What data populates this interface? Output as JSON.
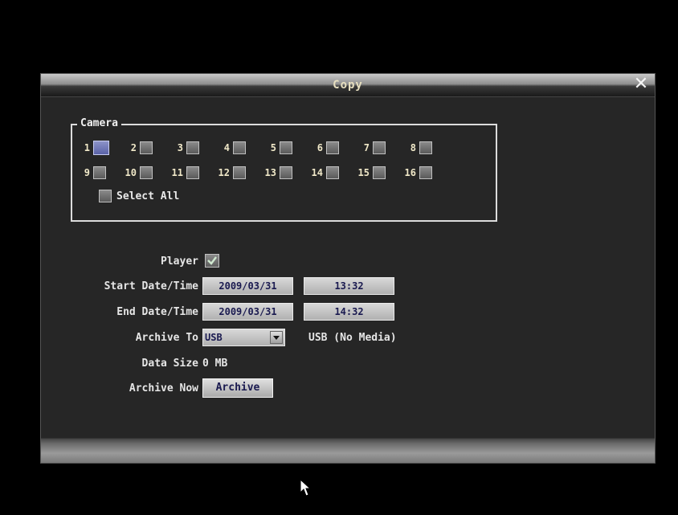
{
  "dialog": {
    "title": "Copy",
    "close_label": "✕"
  },
  "camera": {
    "legend": "Camera",
    "channels": [
      {
        "label": "1",
        "selected": true
      },
      {
        "label": "2",
        "selected": false
      },
      {
        "label": "3",
        "selected": false
      },
      {
        "label": "4",
        "selected": false
      },
      {
        "label": "5",
        "selected": false
      },
      {
        "label": "6",
        "selected": false
      },
      {
        "label": "7",
        "selected": false
      },
      {
        "label": "8",
        "selected": false
      },
      {
        "label": "9",
        "selected": false
      },
      {
        "label": "10",
        "selected": false
      },
      {
        "label": "11",
        "selected": false
      },
      {
        "label": "12",
        "selected": false
      },
      {
        "label": "13",
        "selected": false
      },
      {
        "label": "14",
        "selected": false
      },
      {
        "label": "15",
        "selected": false
      },
      {
        "label": "16",
        "selected": false
      }
    ],
    "select_all_label": "Select All"
  },
  "form": {
    "player_label": "Player",
    "player_checked": true,
    "start_label": "Start Date/Time",
    "start_date": "2009/03/31",
    "start_time": "13:32",
    "end_label": "End Date/Time",
    "end_date": "2009/03/31",
    "end_time": "14:32",
    "archive_to_label": "Archive To",
    "archive_to_value": "USB",
    "archive_status": "USB (No Media)",
    "data_size_label": "Data Size",
    "data_size_value": "0 MB",
    "archive_now_label": "Archive Now",
    "archive_button_label": "Archive"
  },
  "colors": {
    "background": "#000000",
    "dialog_bg": "#262626",
    "selected_channel": "#6a70b8",
    "field_text": "#1a1a50"
  },
  "icons": {
    "close": "close-icon",
    "dropdown": "chevron-down-icon",
    "check": "checkmark-icon",
    "cursor": "mouse-pointer-icon"
  }
}
